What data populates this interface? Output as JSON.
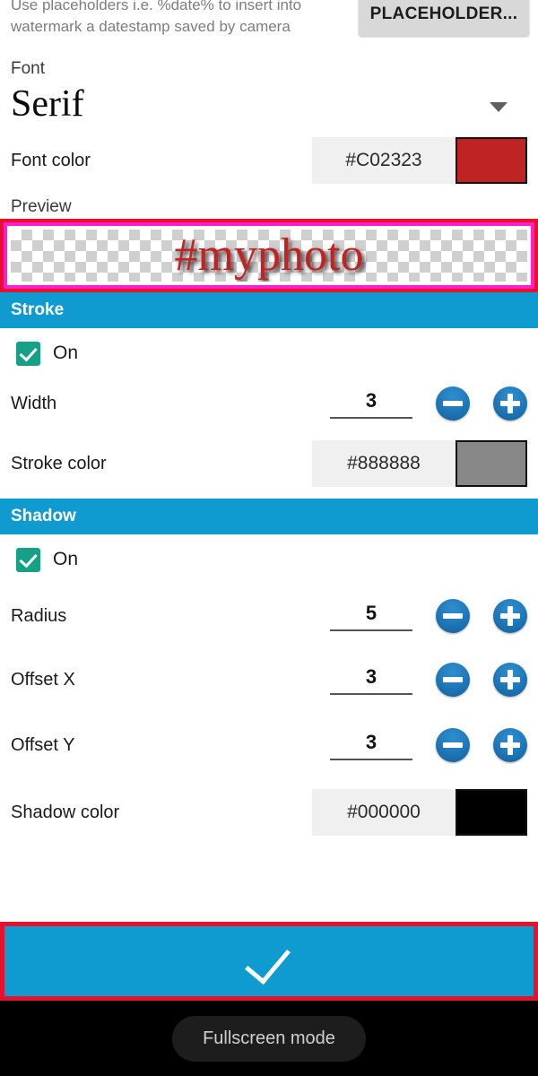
{
  "hint": {
    "text": "Use placeholders i.e. %date% to insert into watermark a datestamp saved by camera",
    "placeholder_button": "PLACEHOLDER..."
  },
  "font": {
    "label": "Font",
    "value": "Serif",
    "dropdown_icon": "chevron-down-icon"
  },
  "font_color": {
    "label": "Font color",
    "hex": "#C02323",
    "swatch": "#C02323"
  },
  "preview": {
    "label": "Preview",
    "text": "#myphoto",
    "highlight_color": "#E8112D",
    "border_color": "#FF1ECB"
  },
  "stroke": {
    "header": "Stroke",
    "enabled_label": "On",
    "width": {
      "label": "Width",
      "value": "3",
      "minus": "minus-icon",
      "plus": "plus-icon"
    },
    "color": {
      "label": "Stroke color",
      "hex": "#888888",
      "swatch": "#888888"
    }
  },
  "shadow": {
    "header": "Shadow",
    "enabled_label": "On",
    "radius": {
      "label": "Radius",
      "value": "5",
      "minus": "minus-icon",
      "plus": "plus-icon"
    },
    "offset_x": {
      "label": "Offset X",
      "value": "3",
      "minus": "minus-icon",
      "plus": "plus-icon"
    },
    "offset_y": {
      "label": "Offset Y",
      "value": "3",
      "minus": "minus-icon",
      "plus": "plus-icon"
    },
    "color": {
      "label": "Shadow color",
      "hex": "#000000",
      "swatch": "#000000"
    }
  },
  "confirm": {
    "icon": "check-icon",
    "accent": "#0F9BD0",
    "highlight_color": "#E8112D"
  },
  "navbar": {
    "toast": "Fullscreen mode"
  }
}
